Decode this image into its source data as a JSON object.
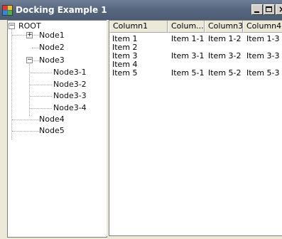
{
  "window": {
    "title": "Docking Example 1",
    "minimize_glyph": "_",
    "close_glyph": "×"
  },
  "tree": {
    "root": "ROOT",
    "node1": "Node1",
    "node2": "Node2",
    "node3": "Node3",
    "node3_1": "Node3-1",
    "node3_2": "Node3-2",
    "node3_3": "Node3-3",
    "node3_4": "Node3-4",
    "node4": "Node4",
    "node5": "Node5",
    "expanded_glyph": "−",
    "collapsed_glyph": "+"
  },
  "list": {
    "columns": [
      "Column1",
      "Colum...",
      "Column3",
      "Column4"
    ],
    "rows": [
      [
        "Item 1",
        "Item 1-1",
        "Item 1-2",
        "Item 1-3"
      ],
      [
        "Item 2",
        "",
        "",
        ""
      ],
      [
        "Item 3",
        "Item 3-1",
        "Item 3-2",
        "Item 3-3"
      ],
      [
        "Item 4",
        "",
        "",
        ""
      ],
      [
        "Item 5",
        "Item 5-1",
        "Item 5-2",
        "Item 5-3"
      ]
    ]
  }
}
